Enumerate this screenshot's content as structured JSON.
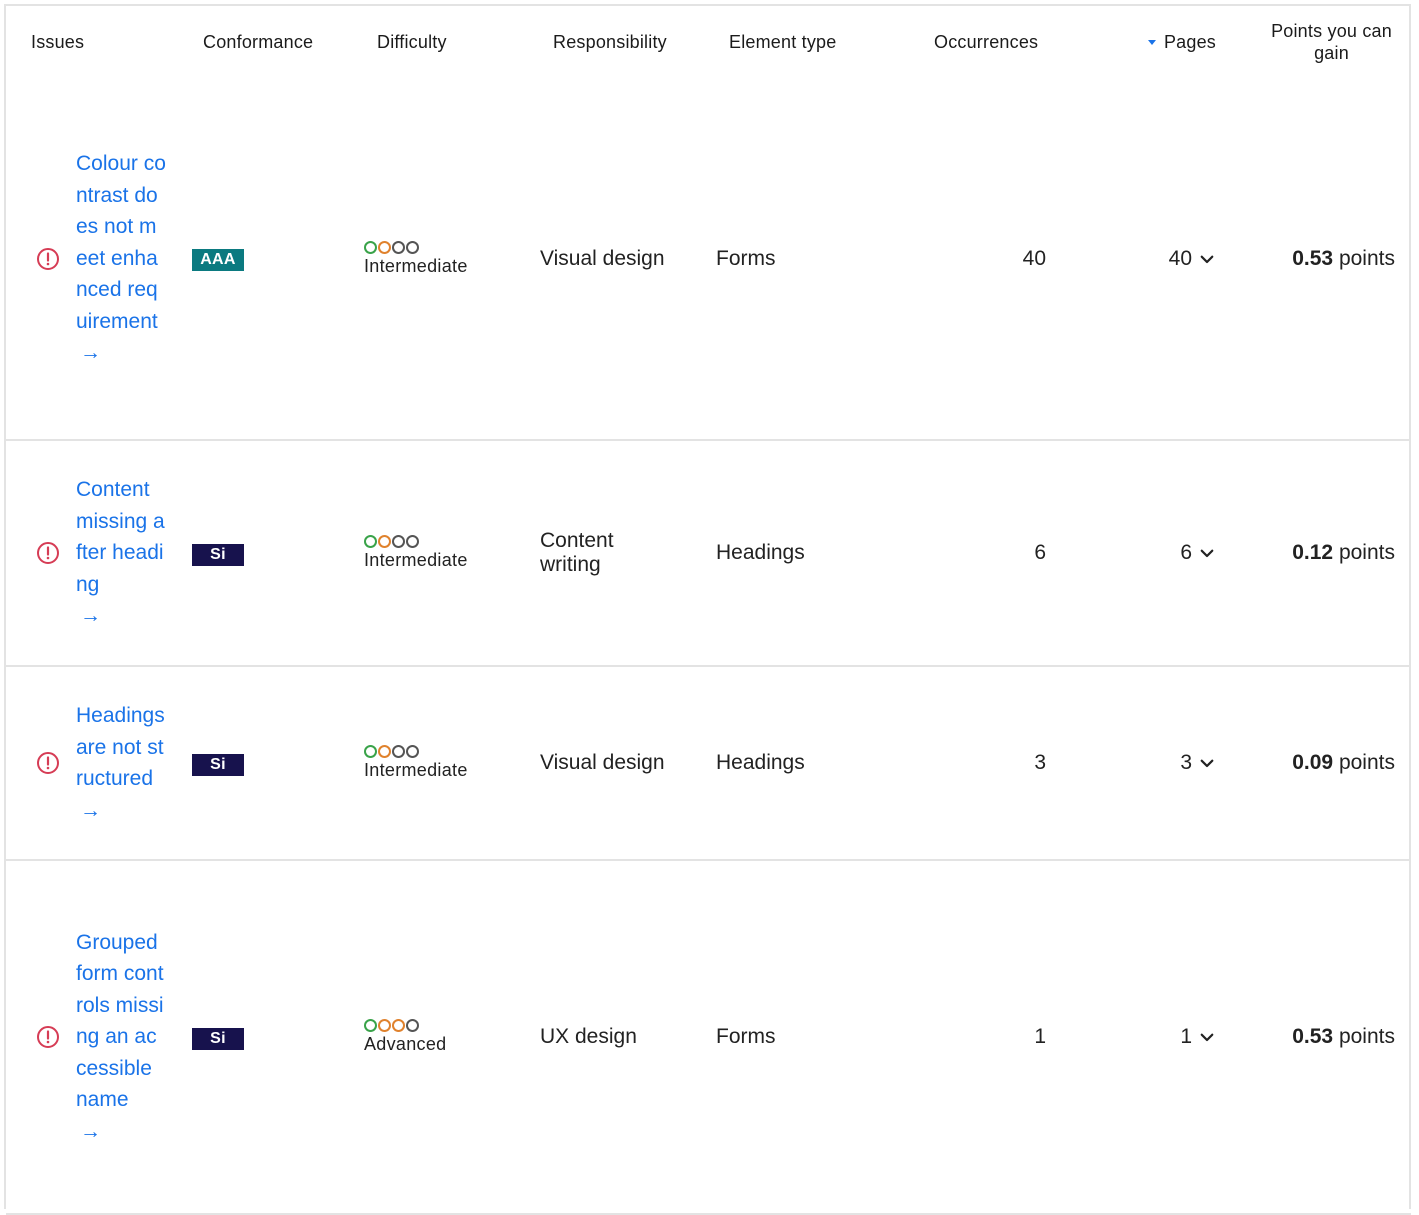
{
  "headers": {
    "issues": "Issues",
    "conformance": "Conformance",
    "difficulty": "Difficulty",
    "responsibility": "Responsibility",
    "element_type": "Element type",
    "occurrences": "Occurrences",
    "pages": "Pages",
    "points": "Points you can gain"
  },
  "arrow": "→",
  "points_suffix": "points",
  "colors": {
    "link": "#1a73e8",
    "alert": "#d63c55",
    "badge_aaa": "#0b7a80",
    "badge_si": "#17124d"
  },
  "rows": [
    {
      "issue": "Colour contrast does not meet enhanced requirement",
      "conformance": "AAA",
      "difficulty_dots": [
        "green",
        "orange",
        "gray",
        "gray"
      ],
      "difficulty": "Intermediate",
      "responsibility": "Visual design",
      "element_type": "Forms",
      "occurrences": "40",
      "pages": "40",
      "points_value": "0.53"
    },
    {
      "issue": "Content missing after heading",
      "conformance": "Si",
      "difficulty_dots": [
        "green",
        "orange",
        "gray",
        "gray"
      ],
      "difficulty": "Intermediate",
      "responsibility": "Content writing",
      "element_type": "Headings",
      "occurrences": "6",
      "pages": "6",
      "points_value": "0.12"
    },
    {
      "issue": "Headings are not structured",
      "conformance": "Si",
      "difficulty_dots": [
        "green",
        "orange",
        "gray",
        "gray"
      ],
      "difficulty": "Intermediate",
      "responsibility": "Visual design",
      "element_type": "Headings",
      "occurrences": "3",
      "pages": "3",
      "points_value": "0.09"
    },
    {
      "issue": "Grouped form controls missing an accessible name",
      "conformance": "Si",
      "difficulty_dots": [
        "green",
        "orange",
        "orange",
        "gray"
      ],
      "difficulty": "Advanced",
      "responsibility": "UX design",
      "element_type": "Forms",
      "occurrences": "1",
      "pages": "1",
      "points_value": "0.53"
    }
  ]
}
